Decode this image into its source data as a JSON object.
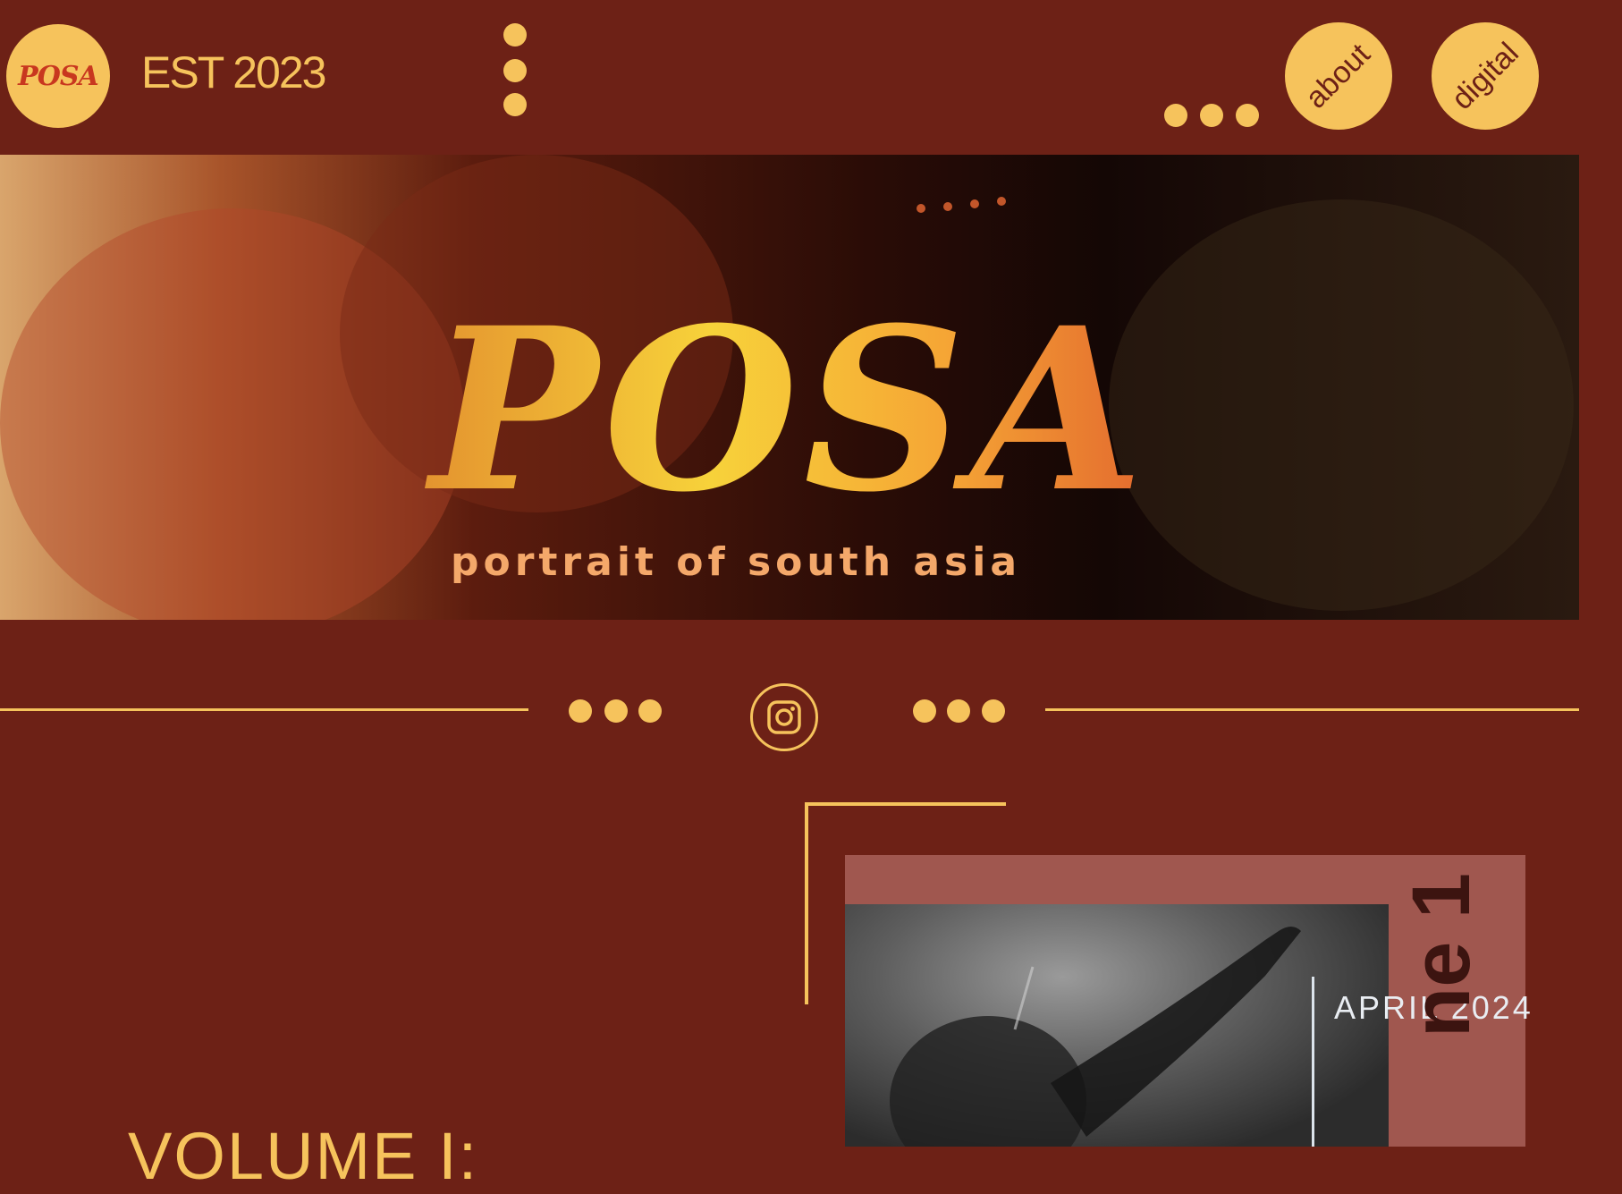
{
  "header": {
    "logo_mark": "POSA",
    "est_label": "EST 2023",
    "nav": [
      {
        "label": "about"
      },
      {
        "label": "digital"
      }
    ]
  },
  "banner": {
    "title": "POSA",
    "subtitle": "portrait of south asia"
  },
  "social": {
    "icon": "instagram-icon"
  },
  "issue": {
    "date": "APRIL 2024",
    "volume_spine": "ne 1",
    "heading": "VOLUME I:"
  },
  "colors": {
    "background": "#6d2116",
    "accent": "#f6c35c",
    "cover_bg": "#a0574f"
  }
}
